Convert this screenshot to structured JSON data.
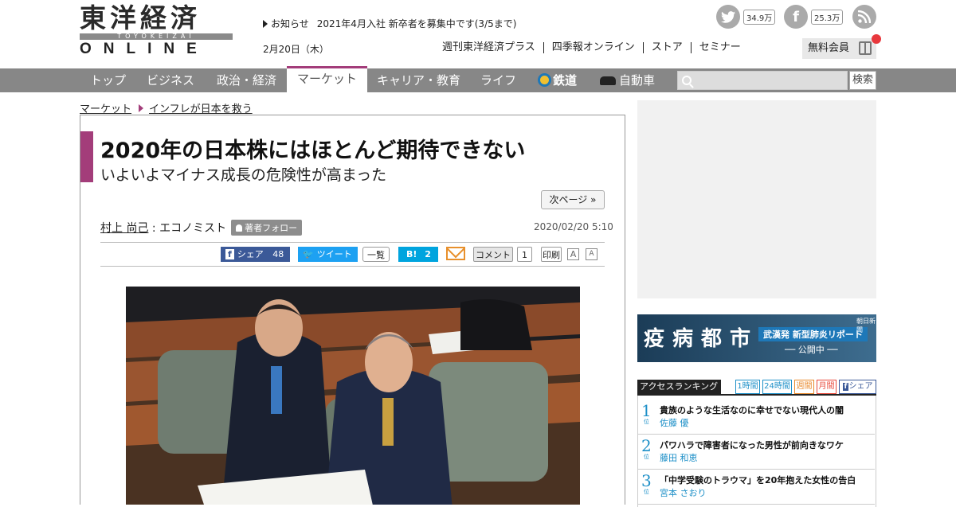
{
  "logo": {
    "jp": "東洋経済",
    "band": "TOYOKEIZAI",
    "en": "ONLINE"
  },
  "notice": {
    "label": "お知らせ",
    "text": "2021年4月入社 新卒者を募集中です(3/5まで)"
  },
  "date": "2月20日（木）",
  "topnav": [
    "週刊東洋経済プラス",
    "四季報オンライン",
    "ストア",
    "セミナー"
  ],
  "social": {
    "twitter": "34.9万",
    "facebook": "25.3万"
  },
  "free_member": "無料会員",
  "nav": [
    "トップ",
    "ビジネス",
    "政治・経済",
    "マーケット",
    "キャリア・教育",
    "ライフ",
    "鉄道",
    "自動車"
  ],
  "search": {
    "placeholder": "",
    "button": "検索"
  },
  "breadcrumb": [
    "マーケット",
    "インフレが日本を救う"
  ],
  "article": {
    "title": "2020年の日本株にはほとんど期待できない",
    "subtitle": "いよいよマイナス成長の危険性が高まった",
    "next": "次ページ »",
    "author": "村上 尚己",
    "author_role": " : エコノミスト",
    "follow": "著者フォロー",
    "published": "2020/02/20 5:10",
    "share": {
      "fb_label": "シェア",
      "fb_count": "48",
      "tw_label": "ツイート",
      "list": "一覧",
      "hb_label": "B!",
      "hb_count": "2",
      "comment": "コメント",
      "comment_count": "1",
      "print": "印刷",
      "font_a": "A",
      "font_a2": "A"
    }
  },
  "banner": {
    "kanji": "疫病都市",
    "tag": "武漢発 新型肺炎リポート",
    "sub": "── 公開中 ──",
    "mark": "朝日新聞"
  },
  "ranking": {
    "title": "アクセスランキング",
    "tabs": [
      "1時間",
      "24時間",
      "週間",
      "月間",
      "シェア"
    ],
    "items": [
      {
        "rank": "1",
        "unit": "位",
        "title": "貴族のような生活なのに幸せでない現代人の闇",
        "author": "佐藤 優"
      },
      {
        "rank": "2",
        "unit": "位",
        "title": "パワハラで障害者になった男性が前向きなワケ",
        "author": "藤田 和恵"
      },
      {
        "rank": "3",
        "unit": "位",
        "title": "「中学受験のトラウマ」を20年抱えた女性の告白",
        "author": "宮本 さおり"
      }
    ]
  },
  "colors": {
    "accent": "#a33d7a",
    "nav_bg": "#878787",
    "rank_blue": "#1e90c8"
  }
}
